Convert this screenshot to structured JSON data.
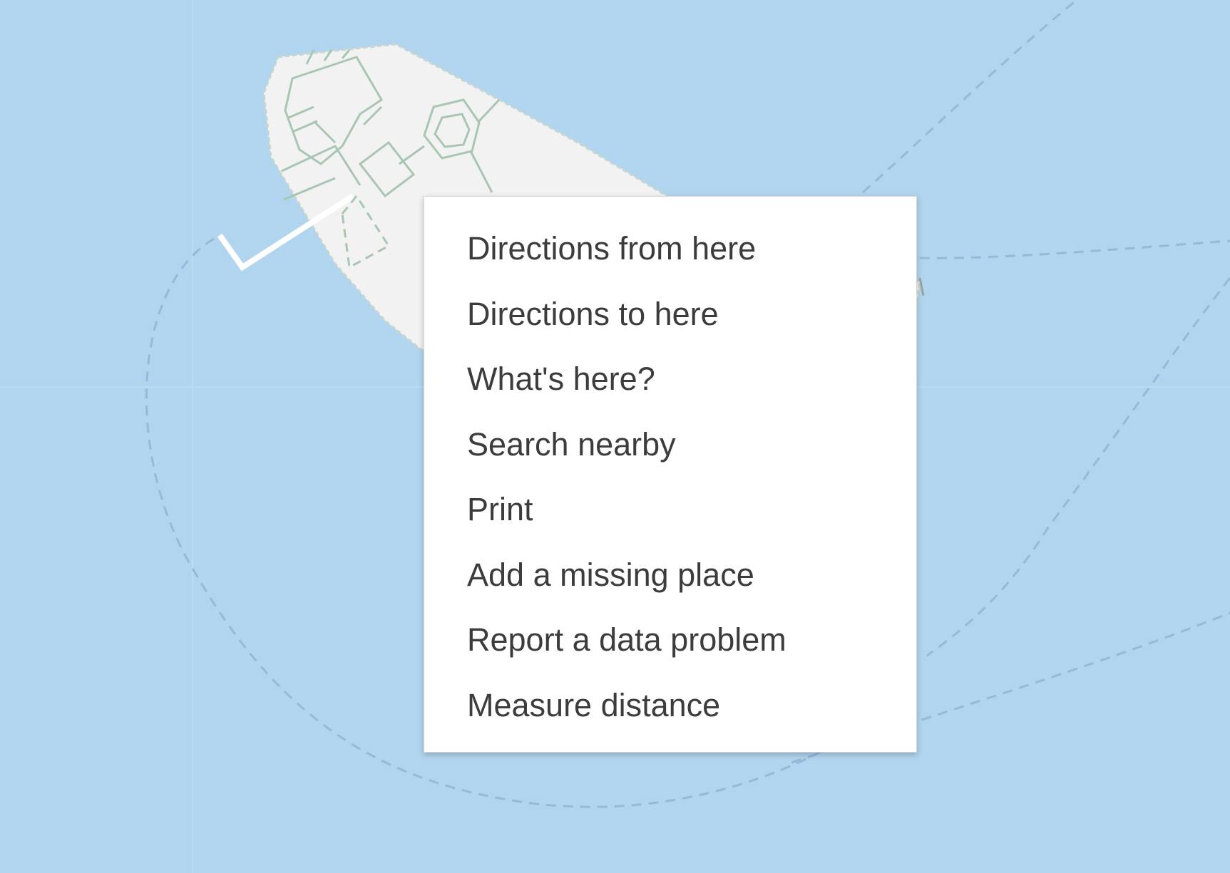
{
  "map": {
    "water_color": "#b1d5ee",
    "land_color": "#f2f2f2",
    "path_color": "#a9c6b2",
    "boundary_color": "#96b9d8"
  },
  "context_menu": {
    "items": [
      {
        "label": "Directions from here"
      },
      {
        "label": "Directions to here"
      },
      {
        "label": "What's here?"
      },
      {
        "label": "Search nearby"
      },
      {
        "label": "Print"
      },
      {
        "label": "Add a missing place"
      },
      {
        "label": "Report a data problem"
      },
      {
        "label": "Measure distance"
      }
    ]
  }
}
